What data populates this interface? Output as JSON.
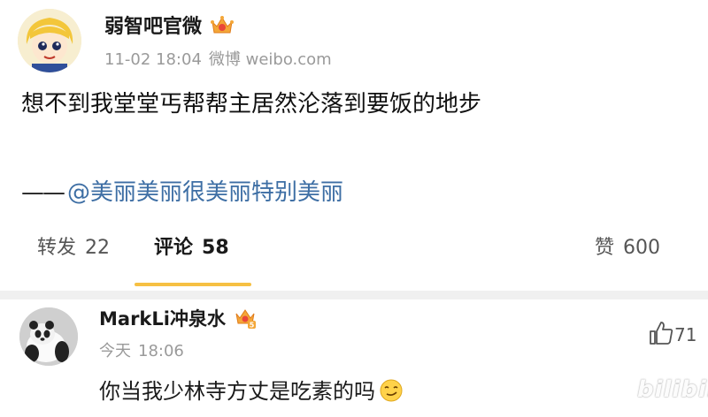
{
  "post": {
    "author": "弱智吧官微",
    "date": "11-02 18:04",
    "source": "微博 weibo.com",
    "text": "想不到我堂堂丐帮帮主居然沦落到要饭的地步",
    "repost_prefix": "——",
    "repost_mention": "@美丽美丽很美丽特别美丽",
    "mention_color": "#3d6ea4"
  },
  "actions": {
    "repost_label": "转发",
    "repost_count": "22",
    "comment_label": "评论",
    "comment_count": "58",
    "like_label": "赞",
    "like_count": "600",
    "active_tab": "comment",
    "indicator_color": "#f6c043"
  },
  "comment": {
    "author": "MarkLi冲泉水",
    "badge_level": "5",
    "time_day": "今天",
    "time_clock": "18:06",
    "text": "你当我少林寺方丈是吃素的吗",
    "emoji": "smirk-emoji",
    "like_count": "71"
  },
  "watermark": "bilibili"
}
